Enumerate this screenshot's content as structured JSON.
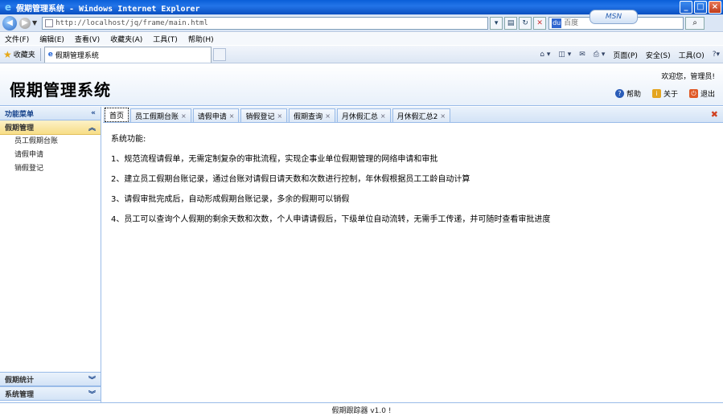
{
  "window": {
    "title": "假期管理系统 - Windows Internet Explorer",
    "controls": [
      "_",
      "□",
      "×"
    ]
  },
  "browser": {
    "url": "http://localhost/jq/frame/main.html",
    "search_placeholder": "百度",
    "search_tab_label": "MSN",
    "menu": [
      "文件(F)",
      "编辑(E)",
      "查看(V)",
      "收藏夹(A)",
      "工具(T)",
      "帮助(H)"
    ],
    "favorites_label": "收藏夹",
    "active_tab": "假期管理系统",
    "commands": [
      "页面(P)",
      "安全(S)",
      "工具(O)"
    ]
  },
  "header": {
    "title": "假期管理系统",
    "welcome": "欢迎您，管理员!",
    "actions": [
      {
        "label": "帮助",
        "icon": "help-icon"
      },
      {
        "label": "关于",
        "icon": "about-icon"
      },
      {
        "label": "退出",
        "icon": "logout-icon"
      }
    ]
  },
  "sidebar": {
    "header": "功能菜单",
    "sections": [
      {
        "title": "假期管理",
        "expanded": true,
        "items": [
          "员工假期台账",
          "请假申请",
          "销假登记"
        ]
      },
      {
        "title": "假期统计",
        "expanded": false
      },
      {
        "title": "系统管理",
        "expanded": false
      }
    ]
  },
  "tabs": [
    {
      "label": "首页",
      "active": true,
      "closable": false
    },
    {
      "label": "员工假期台账",
      "active": false,
      "closable": true
    },
    {
      "label": "请假申请",
      "active": false,
      "closable": true
    },
    {
      "label": "销假登记",
      "active": false,
      "closable": true
    },
    {
      "label": "假期查询",
      "active": false,
      "closable": true
    },
    {
      "label": "月休假汇总",
      "active": false,
      "closable": true
    },
    {
      "label": "月休假汇总2",
      "active": false,
      "closable": true
    }
  ],
  "content": {
    "heading": "系统功能:",
    "features": [
      "1、规范流程请假单，无需定制复杂的审批流程，实现企事业单位假期管理的网络申请和审批",
      "2、建立员工假期台账记录，通过台账对请假日请天数和次数进行控制，年休假根据员工工龄自动计算",
      "3、请假审批完成后，自动形成假期台账记录，多余的假期可以销假",
      "4、员工可以查询个人假期的剩余天数和次数，个人申请请假后，下级单位自动流转，无需手工传递，并可随时查看审批进度"
    ]
  },
  "footer": {
    "text": "假期跟踪器 v1.0 !"
  },
  "colors": {
    "accent_border": "#99bbe8",
    "expanded_section_bg": "#f7dd86",
    "titlebar_blue": "#0a5fd8"
  }
}
